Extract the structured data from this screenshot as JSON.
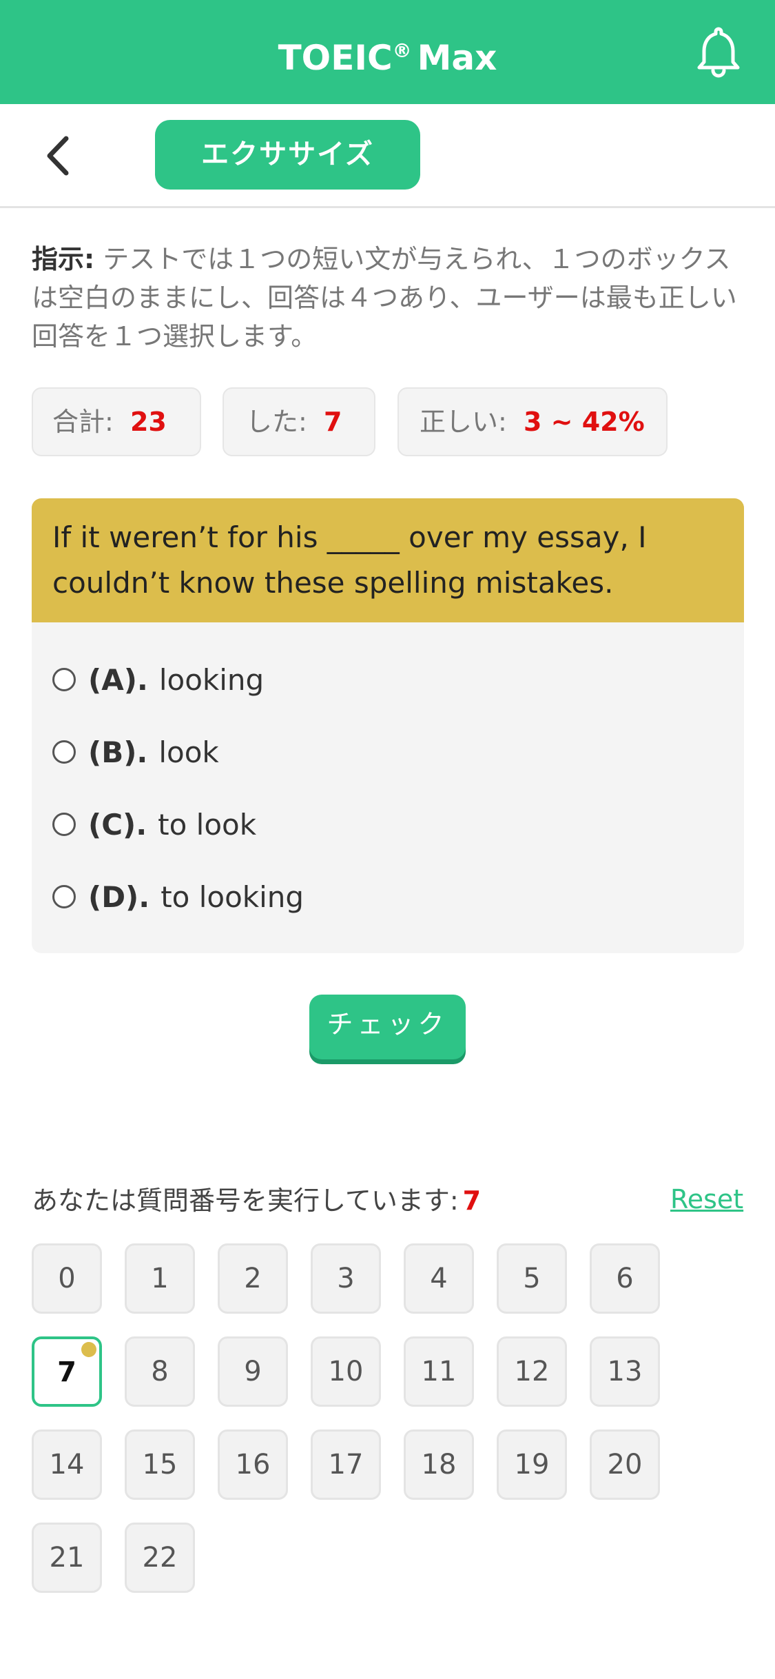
{
  "header": {
    "title": "TOEIC",
    "title_sup": "®",
    "title_tail": "Max",
    "notification_icon": "bell-icon"
  },
  "subnav": {
    "back_icon": "chevron-left-icon",
    "exercise_label": "エクササイズ"
  },
  "instructions": {
    "lead": "指示:",
    "text": " テストでは１つの短い文が与えられ、１つのボックスは空白のままにし、回答は４つあり、ユーザーは最も正しい回答を１つ選択します。"
  },
  "stats": {
    "total_label": "合計:",
    "total_value": "23",
    "done_label": "した:",
    "done_value": "7",
    "correct_label": "正しい:",
    "correct_value": "3 ~ 42%"
  },
  "question": {
    "text": "If it weren’t for his _____ over my essay, I couldn’t know these spelling mistakes.",
    "options": [
      {
        "letter": "(A).",
        "text": "looking"
      },
      {
        "letter": "(B).",
        "text": "look"
      },
      {
        "letter": "(C).",
        "text": "to look"
      },
      {
        "letter": "(D).",
        "text": "to looking"
      }
    ]
  },
  "check_label": "チェック",
  "running": {
    "label": "あなたは質問番号を実行しています:",
    "value": "7",
    "reset_label": "Reset"
  },
  "numbers": [
    "0",
    "1",
    "2",
    "3",
    "4",
    "5",
    "6",
    "7",
    "8",
    "9",
    "10",
    "11",
    "12",
    "13",
    "14",
    "15",
    "16",
    "17",
    "18",
    "19",
    "20",
    "21",
    "22"
  ],
  "current_number": "7",
  "colors": {
    "brand_green": "#2ec487",
    "question_yellow": "#dcbd4c",
    "highlight_red": "#e01010"
  }
}
